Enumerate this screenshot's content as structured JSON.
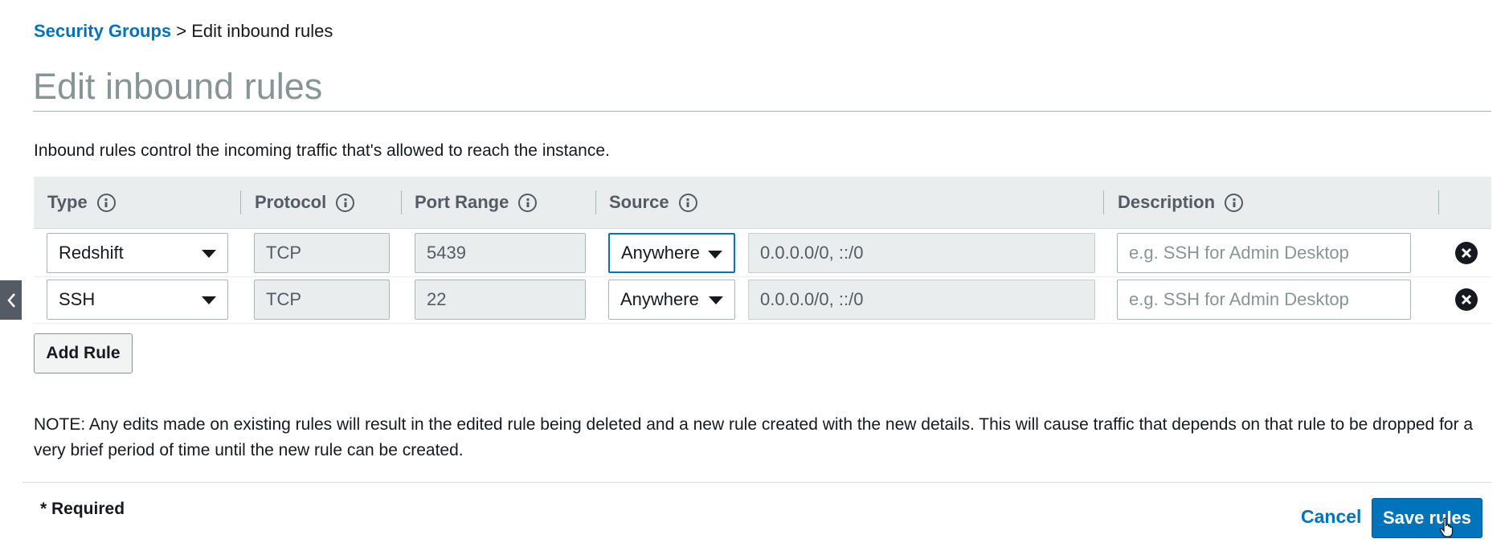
{
  "breadcrumb": {
    "parent": "Security Groups",
    "separator": " > ",
    "current": "Edit inbound rules"
  },
  "page_title": "Edit inbound rules",
  "intro_text": "Inbound rules control the incoming traffic that's allowed to reach the instance.",
  "columns": [
    {
      "label": "Type",
      "icon": "info-icon"
    },
    {
      "label": "Protocol",
      "icon": "info-icon"
    },
    {
      "label": "Port Range",
      "icon": "info-icon"
    },
    {
      "label": "Source",
      "icon": "info-icon"
    },
    {
      "label": "Description",
      "icon": "info-icon"
    }
  ],
  "rules": [
    {
      "type": "Redshift",
      "protocol": "TCP",
      "port_range": "5439",
      "source": "Anywhere",
      "source_value": "0.0.0.0/0, ::/0",
      "description_placeholder": "e.g. SSH for Admin Desktop",
      "remove_icon": "remove-circle-icon"
    },
    {
      "type": "SSH",
      "protocol": "TCP",
      "port_range": "22",
      "source": "Anywhere",
      "source_value": "0.0.0.0/0, ::/0",
      "description_placeholder": "e.g. SSH for Admin Desktop",
      "remove_icon": "remove-circle-icon"
    }
  ],
  "add_rule_label": "Add Rule",
  "note": "NOTE: Any edits made on existing rules will result in the edited rule being deleted and a new rule created with the new details. This will cause traffic that depends on that rule to be dropped for a very brief period of time until the new rule can be created.",
  "required_label": "* Required",
  "cancel_label": "Cancel",
  "save_label": "Save rules",
  "colors": {
    "link": "#0073bb",
    "primary_button": "#0073bb",
    "header_bg": "#eaeded",
    "readonly_field": "#eaeded",
    "title": "#879596",
    "side_tab": "#545b64"
  },
  "icons": {
    "side_tab": "chevron-left-icon",
    "dropdown": "caret-down-icon",
    "pointer": "hand-cursor-icon"
  }
}
